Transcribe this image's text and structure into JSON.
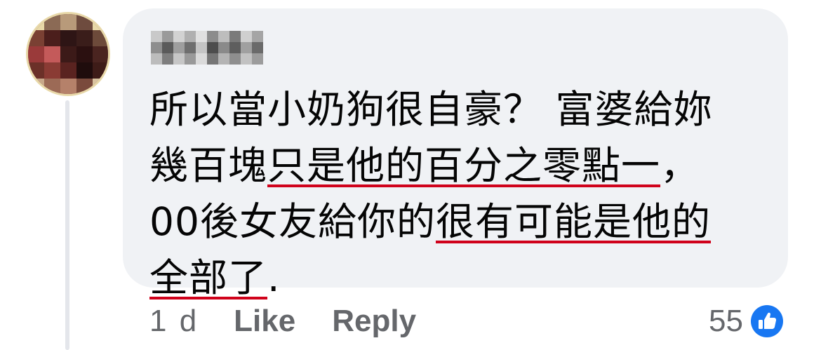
{
  "comment": {
    "author_name": "",
    "text_lines": [
      [
        {
          "t": "所以當小奶狗很自豪？ 富婆給妳",
          "hl": false
        }
      ],
      [
        {
          "t": "幾百塊",
          "hl": false
        },
        {
          "t": "只是他的百分之零點一",
          "hl": true
        },
        {
          "t": "，",
          "hl": false
        }
      ],
      [
        {
          "t": "00後女友給你的",
          "hl": false
        },
        {
          "t": "很有可能是他的",
          "hl": true
        }
      ],
      [
        {
          "t": "全部了",
          "hl": true
        },
        {
          "t": ".",
          "hl": false
        }
      ]
    ],
    "highlight_color": "#d0021b"
  },
  "actions": {
    "timestamp": "1 d",
    "like_label": "Like",
    "reply_label": "Reply"
  },
  "reactions": {
    "count": "55",
    "icon": "thumbs-up-icon",
    "color": "#1877f2"
  }
}
